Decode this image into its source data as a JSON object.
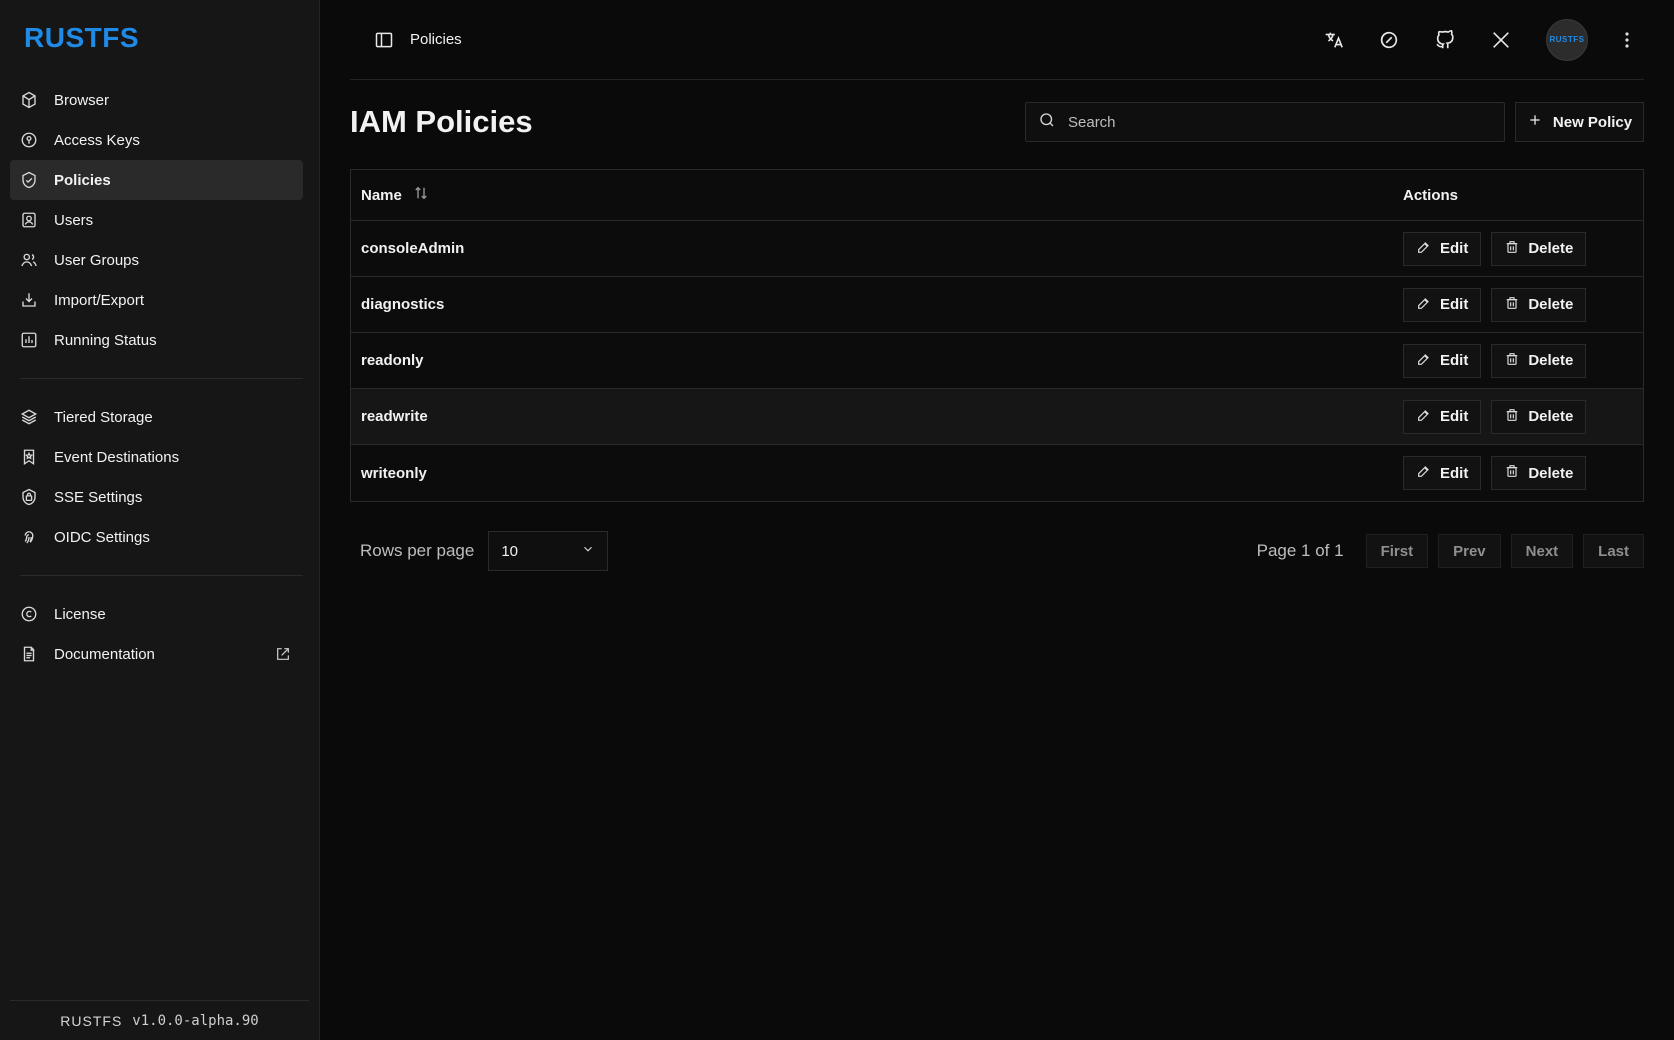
{
  "brand": {
    "logo": "RUSTFS",
    "footer_brand": "RUSTFS",
    "version": "v1.0.0-alpha.90",
    "accent": "#1f8be6"
  },
  "sidebar": {
    "sections": [
      {
        "items": [
          {
            "label": "Browser",
            "icon": "cube-icon"
          },
          {
            "label": "Access Keys",
            "icon": "key-icon"
          },
          {
            "label": "Policies",
            "icon": "shield-icon",
            "active": true
          },
          {
            "label": "Users",
            "icon": "user-badge-icon"
          },
          {
            "label": "User Groups",
            "icon": "users-icon"
          },
          {
            "label": "Import/Export",
            "icon": "download-icon"
          },
          {
            "label": "Running Status",
            "icon": "bar-chart-icon"
          }
        ]
      },
      {
        "items": [
          {
            "label": "Tiered Storage",
            "icon": "layers-icon"
          },
          {
            "label": "Event Destinations",
            "icon": "bookmark-star-icon"
          },
          {
            "label": "SSE Settings",
            "icon": "lock-shield-icon"
          },
          {
            "label": "OIDC Settings",
            "icon": "fingerprint-icon"
          }
        ]
      },
      {
        "items": [
          {
            "label": "License",
            "icon": "copyright-icon"
          },
          {
            "label": "Documentation",
            "icon": "document-icon",
            "external": true
          }
        ]
      }
    ]
  },
  "topbar": {
    "breadcrumb": "Policies",
    "icons": [
      "translate-icon",
      "theme-icon",
      "github-icon",
      "x-icon"
    ],
    "avatar_text": "RUSTFS"
  },
  "page": {
    "title": "IAM Policies",
    "search_placeholder": "Search",
    "new_button": "New Policy"
  },
  "table": {
    "headers": {
      "name": "Name",
      "actions": "Actions"
    },
    "rows": [
      {
        "name": "consoleAdmin"
      },
      {
        "name": "diagnostics"
      },
      {
        "name": "readonly"
      },
      {
        "name": "readwrite",
        "highlight": true
      },
      {
        "name": "writeonly"
      }
    ],
    "actions": {
      "edit": "Edit",
      "delete": "Delete"
    }
  },
  "pagination": {
    "rows_label": "Rows per page",
    "rows_value": "10",
    "page_text": "Page 1 of 1",
    "buttons": [
      "First",
      "Prev",
      "Next",
      "Last"
    ]
  }
}
